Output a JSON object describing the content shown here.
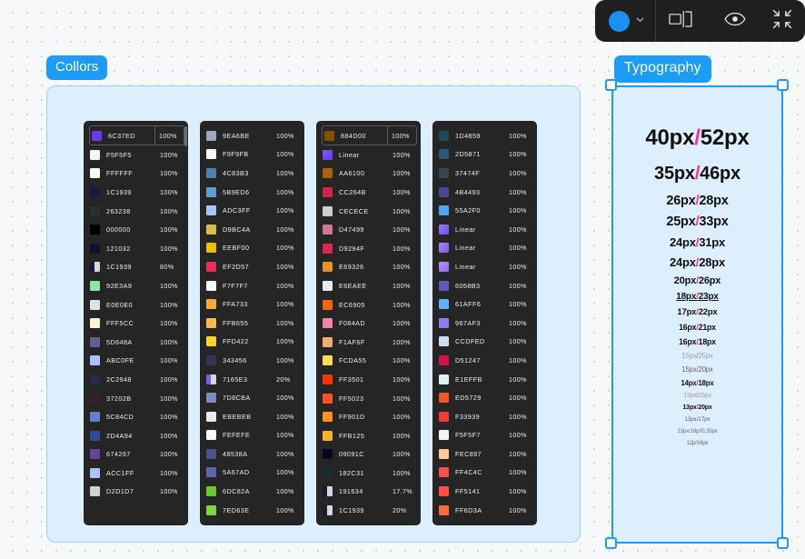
{
  "toolbar": {
    "color_dot_hex": "#1c90f0",
    "items": [
      {
        "name": "color-picker",
        "icon": "circle-swatch"
      },
      {
        "name": "chevron",
        "icon": "chevron-down-icon"
      },
      {
        "name": "spacing",
        "icon": "spacing-measure-icon"
      },
      {
        "name": "preview",
        "icon": "eye-icon"
      },
      {
        "name": "fullscreen",
        "icon": "collapse-arrows-icon"
      }
    ]
  },
  "sections": {
    "colors_label": "Collors",
    "typography_label": "Typography"
  },
  "colors": {
    "opacity_header": "",
    "columns": [
      {
        "scrollbar": true,
        "rows": [
          {
            "hex": "6C37ED",
            "swatch": "#6C37ED",
            "opacity": "100%",
            "selected": true
          },
          {
            "hex": "F5F5F5",
            "swatch": "#F5F5F5",
            "opacity": "100%"
          },
          {
            "hex": "FFFFFF",
            "swatch": "#FFFFFF",
            "opacity": "100%"
          },
          {
            "hex": "1C1939",
            "swatch": "#1C1939",
            "opacity": "100%"
          },
          {
            "hex": "263238",
            "swatch": "#263238",
            "opacity": "100%"
          },
          {
            "hex": "000000",
            "swatch": "#000000",
            "opacity": "100%"
          },
          {
            "hex": "121032",
            "swatch": "#121032",
            "opacity": "100%"
          },
          {
            "hex": "1C1939",
            "swatch": "#1C1939",
            "opacity": "80%",
            "alpha": true
          },
          {
            "hex": "92E3A9",
            "swatch": "#92E3A9",
            "opacity": "100%"
          },
          {
            "hex": "E0E0E0",
            "swatch": "#E0E0E0",
            "opacity": "100%"
          },
          {
            "hex": "FFF5CC",
            "swatch": "#FFF5CC",
            "opacity": "100%"
          },
          {
            "hex": "5D648A",
            "swatch": "#5D648A",
            "opacity": "100%"
          },
          {
            "hex": "ABC0FE",
            "swatch": "#ABC0FE",
            "opacity": "100%"
          },
          {
            "hex": "2C2948",
            "swatch": "#2C2948",
            "opacity": "100%"
          },
          {
            "hex": "37202B",
            "swatch": "#37202B",
            "opacity": "100%"
          },
          {
            "hex": "5C84CD",
            "swatch": "#5C84CD",
            "opacity": "100%"
          },
          {
            "hex": "2D4A94",
            "swatch": "#2D4A94",
            "opacity": "100%"
          },
          {
            "hex": "674297",
            "swatch": "#674297",
            "opacity": "100%"
          },
          {
            "hex": "ACC1FF",
            "swatch": "#ACC1FF",
            "opacity": "100%"
          },
          {
            "hex": "D2D1D7",
            "swatch": "#D2D1D7",
            "opacity": "100%"
          }
        ]
      },
      {
        "rows": [
          {
            "hex": "9EA6BE",
            "swatch": "#9EA6BE",
            "opacity": "100%"
          },
          {
            "hex": "F9F9FB",
            "swatch": "#F9F9FB",
            "opacity": "100%"
          },
          {
            "hex": "4C83B3",
            "swatch": "#4C83B3",
            "opacity": "100%"
          },
          {
            "hex": "5B9ED6",
            "swatch": "#5B9ED6",
            "opacity": "100%"
          },
          {
            "hex": "ADC3FF",
            "swatch": "#ADC3FF",
            "opacity": "100%"
          },
          {
            "hex": "D9BC4A",
            "swatch": "#D9BC4A",
            "opacity": "100%"
          },
          {
            "hex": "EEBF00",
            "swatch": "#EEBF00",
            "opacity": "100%"
          },
          {
            "hex": "EF2D57",
            "swatch": "#EF2D57",
            "opacity": "100%"
          },
          {
            "hex": "F7F7F7",
            "swatch": "#F7F7F7",
            "opacity": "100%"
          },
          {
            "hex": "FFA733",
            "swatch": "#FFA733",
            "opacity": "100%"
          },
          {
            "hex": "FFB655",
            "swatch": "#FFB655",
            "opacity": "100%"
          },
          {
            "hex": "FFD422",
            "swatch": "#FFD422",
            "opacity": "100%"
          },
          {
            "hex": "343456",
            "swatch": "#343456",
            "opacity": "100%"
          },
          {
            "hex": "7165E3",
            "swatch": "#7165E3",
            "opacity": "20%",
            "alpha": true
          },
          {
            "hex": "7D8CBA",
            "swatch": "#7D8CBA",
            "opacity": "100%"
          },
          {
            "hex": "EBEBEB",
            "swatch": "#EBEBEB",
            "opacity": "100%"
          },
          {
            "hex": "FEFEFE",
            "swatch": "#FEFEFE",
            "opacity": "100%"
          },
          {
            "hex": "48538A",
            "swatch": "#48538A",
            "opacity": "100%"
          },
          {
            "hex": "5A67AD",
            "swatch": "#5A67AD",
            "opacity": "100%"
          },
          {
            "hex": "6DC82A",
            "swatch": "#6DC82A",
            "opacity": "100%"
          },
          {
            "hex": "7ED63E",
            "swatch": "#7ED63E",
            "opacity": "100%"
          }
        ]
      },
      {
        "rows": [
          {
            "hex": "884D00",
            "swatch": "#884D00",
            "opacity": "100%",
            "selected": true
          },
          {
            "hex": "Linear",
            "swatch": "linear-gradient(135deg,#7b5bf5,#6c37ed)",
            "opacity": "100%",
            "gradient": true
          },
          {
            "hex": "AA6100",
            "swatch": "#AA6100",
            "opacity": "100%"
          },
          {
            "hex": "CC264B",
            "swatch": "#CC264B",
            "opacity": "100%"
          },
          {
            "hex": "CECECE",
            "swatch": "#CECECE",
            "opacity": "100%"
          },
          {
            "hex": "D47499",
            "swatch": "#D47499",
            "opacity": "100%"
          },
          {
            "hex": "D9294F",
            "swatch": "#D9294F",
            "opacity": "100%"
          },
          {
            "hex": "E69326",
            "swatch": "#E69326",
            "opacity": "100%"
          },
          {
            "hex": "E6EAEE",
            "swatch": "#E6EAEE",
            "opacity": "100%"
          },
          {
            "hex": "EC6905",
            "swatch": "#EC6905",
            "opacity": "100%"
          },
          {
            "hex": "F084AD",
            "swatch": "#F084AD",
            "opacity": "100%"
          },
          {
            "hex": "F1AF6F",
            "swatch": "#F1AF6F",
            "opacity": "100%"
          },
          {
            "hex": "FCDA55",
            "swatch": "#FCDA55",
            "opacity": "100%"
          },
          {
            "hex": "FF3501",
            "swatch": "#FF3501",
            "opacity": "100%"
          },
          {
            "hex": "FF5023",
            "swatch": "#FF5023",
            "opacity": "100%"
          },
          {
            "hex": "FF901D",
            "swatch": "#FF901D",
            "opacity": "100%"
          },
          {
            "hex": "FFB125",
            "swatch": "#FFB125",
            "opacity": "100%"
          },
          {
            "hex": "09091C",
            "swatch": "#09091C",
            "opacity": "100%"
          },
          {
            "hex": "182C31",
            "swatch": "#182C31",
            "opacity": "100%"
          },
          {
            "hex": "191634",
            "swatch": "#191634",
            "opacity": "17.7%",
            "alpha": true
          },
          {
            "hex": "1C1939",
            "swatch": "#1C1939",
            "opacity": "20%",
            "alpha": true
          }
        ]
      },
      {
        "rows": [
          {
            "hex": "1D4859",
            "swatch": "#1D4859",
            "opacity": "100%"
          },
          {
            "hex": "2D5871",
            "swatch": "#2D5871",
            "opacity": "100%"
          },
          {
            "hex": "37474F",
            "swatch": "#37474F",
            "opacity": "100%"
          },
          {
            "hex": "4B4493",
            "swatch": "#4B4493",
            "opacity": "100%"
          },
          {
            "hex": "55A2F0",
            "swatch": "#55A2F0",
            "opacity": "100%"
          },
          {
            "hex": "Linear",
            "swatch": "linear-gradient(135deg,#9b7bf7,#6c4bee)",
            "opacity": "100%",
            "gradient": true
          },
          {
            "hex": "Linear",
            "swatch": "linear-gradient(135deg,#a98bf9,#7b55f0)",
            "opacity": "100%",
            "gradient": true
          },
          {
            "hex": "Linear",
            "swatch": "linear-gradient(135deg,#b094fa,#8b68f2)",
            "opacity": "100%",
            "gradient": true
          },
          {
            "hex": "6058B3",
            "swatch": "#6058B3",
            "opacity": "100%"
          },
          {
            "hex": "61AFF6",
            "swatch": "#61AFF6",
            "opacity": "100%"
          },
          {
            "hex": "967AF3",
            "swatch": "#967AF3",
            "opacity": "100%"
          },
          {
            "hex": "CCDFED",
            "swatch": "#CCDFED",
            "opacity": "100%"
          },
          {
            "hex": "D51247",
            "swatch": "#D51247",
            "opacity": "100%"
          },
          {
            "hex": "E1EFFB",
            "swatch": "#E1EFFB",
            "opacity": "100%"
          },
          {
            "hex": "ED5729",
            "swatch": "#ED5729",
            "opacity": "100%"
          },
          {
            "hex": "F33939",
            "swatch": "#F33939",
            "opacity": "100%"
          },
          {
            "hex": "F5F5F7",
            "swatch": "#F5F5F7",
            "opacity": "100%"
          },
          {
            "hex": "FEC897",
            "swatch": "#FEC897",
            "opacity": "100%"
          },
          {
            "hex": "FF4C4C",
            "swatch": "#FF4C4C",
            "opacity": "100%"
          },
          {
            "hex": "FF5141",
            "swatch": "#FF5141",
            "opacity": "100%"
          },
          {
            "hex": "FF6D3A",
            "swatch": "#FF6D3A",
            "opacity": "100%"
          }
        ]
      }
    ]
  },
  "typography": {
    "separator_color": "#ff2d9b",
    "items": [
      {
        "size": "40px",
        "sep": "/",
        "line": "52px",
        "font_px": 24,
        "weight": 700,
        "color": "#111111",
        "mb": 14
      },
      {
        "size": "35px",
        "sep": "/",
        "line": "46px",
        "font_px": 20,
        "weight": 700,
        "color": "#111111",
        "mb": 10
      },
      {
        "size": "26px",
        "sep": "/",
        "line": "28px",
        "font_px": 14.5,
        "weight": 700,
        "color": "#111111",
        "mb": 7
      },
      {
        "size": "25px",
        "sep": "/",
        "line": "33px",
        "font_px": 14.5,
        "weight": 700,
        "color": "#111111",
        "mb": 7
      },
      {
        "size": "24px",
        "sep": "/",
        "line": "31px",
        "font_px": 13,
        "weight": 700,
        "color": "#111111",
        "mb": 7
      },
      {
        "size": "24px",
        "sep": "/",
        "line": "28px",
        "font_px": 13,
        "weight": 700,
        "color": "#111111",
        "mb": 7
      },
      {
        "size": "20px",
        "sep": "/",
        "line": "26px",
        "font_px": 11,
        "weight": 700,
        "color": "#111111",
        "mb": 6
      },
      {
        "size": "18px",
        "sep": "/",
        "line": "23px",
        "font_px": 10,
        "weight": 700,
        "color": "#111111",
        "mb": 6,
        "underline": true
      },
      {
        "size": "17px",
        "sep": "/",
        "line": "22px",
        "font_px": 9.5,
        "weight": 700,
        "color": "#111111",
        "mb": 6
      },
      {
        "size": "16px",
        "sep": "/",
        "line": "21px",
        "font_px": 8.8,
        "weight": 700,
        "color": "#111111",
        "mb": 6
      },
      {
        "size": "16px",
        "sep": "/",
        "line": "18px",
        "font_px": 8.8,
        "weight": 700,
        "color": "#111111",
        "mb": 6
      },
      {
        "size": "15px",
        "sep": "/",
        "line": "25px",
        "font_px": 7.8,
        "weight": 400,
        "color": "#9aa3ad",
        "mb": 6
      },
      {
        "size": "15px",
        "sep": "/",
        "line": "20px",
        "font_px": 7.8,
        "weight": 400,
        "color": "#5c6670",
        "mb": 6
      },
      {
        "size": "14px",
        "sep": "/",
        "line": "18px",
        "font_px": 7.8,
        "weight": 700,
        "color": "#111111",
        "mb": 6
      },
      {
        "size": "13px",
        "sep": "/",
        "line": "25px",
        "font_px": 7,
        "weight": 400,
        "color": "#9aa3ad",
        "mb": 6
      },
      {
        "size": "13px",
        "sep": "/",
        "line": "20px",
        "font_px": 7,
        "weight": 700,
        "color": "#111111",
        "mb": 6
      },
      {
        "size": "13px",
        "sep": "/",
        "line": "17px",
        "font_px": 6.5,
        "weight": 400,
        "color": "#5c6670",
        "mb": 6
      },
      {
        "size": "13px/18p",
        "sep": "/",
        "line": "/0.35px",
        "font_px": 6.2,
        "weight": 400,
        "color": "#6d767f",
        "mb": 6
      },
      {
        "size": "12p",
        "sep": "/",
        "line": "16px",
        "font_px": 6.2,
        "weight": 400,
        "color": "#5c6670",
        "mb": 0
      }
    ]
  }
}
